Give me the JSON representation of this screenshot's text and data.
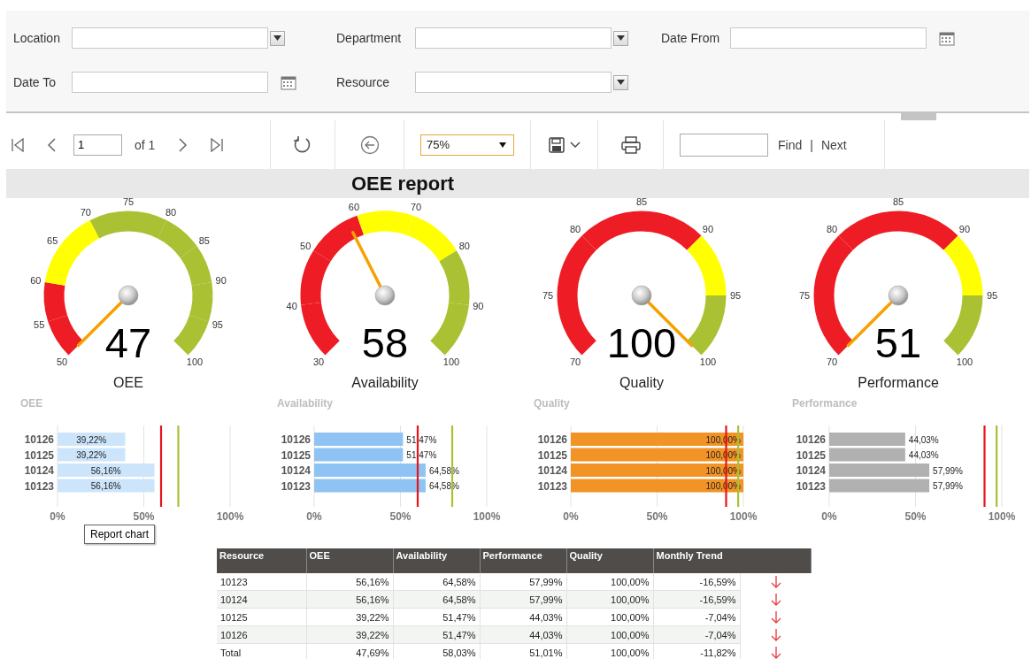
{
  "filters": [
    {
      "label": "Location",
      "kind": "select"
    },
    {
      "label": "Department",
      "kind": "select"
    },
    {
      "label": "Date From",
      "kind": "date"
    },
    {
      "label": "Date To",
      "kind": "date"
    },
    {
      "label": "Resource",
      "kind": "select"
    }
  ],
  "toolbar": {
    "page": "1",
    "page_count": "of 1",
    "zoom": "75%",
    "find_button": "Find",
    "separator": "|",
    "next_button": "Next"
  },
  "report_title": "OEE report",
  "gauges": [
    {
      "label": "OEE",
      "value": "47",
      "ticks": [
        "50",
        "55",
        "60",
        "65",
        "70",
        "75",
        "80",
        "85",
        "90",
        "95",
        "100"
      ],
      "segments": [
        {
          "color": "#ee1c25"
        },
        {
          "color": "#ee1c25"
        },
        {
          "color": "#ffff00"
        },
        {
          "color": "#ffff00"
        },
        {
          "color": "#a9c133"
        },
        {
          "color": "#a9c133"
        },
        {
          "color": "#a9c133"
        },
        {
          "color": "#a9c133"
        },
        {
          "color": "#a9c133"
        },
        {
          "color": "#a9c133"
        }
      ]
    },
    {
      "label": "Availability",
      "value": "58",
      "ticks": [
        "30",
        "40",
        "50",
        "60",
        "70",
        "80",
        "90",
        "100"
      ],
      "segments": [
        {
          "color": "#ee1c25"
        },
        {
          "color": "#ee1c25"
        },
        {
          "color": "#ee1c25"
        },
        {
          "color": "#ffff00"
        },
        {
          "color": "#ffff00"
        },
        {
          "color": "#a9c133"
        },
        {
          "color": "#a9c133"
        }
      ]
    },
    {
      "label": "Quality",
      "value": "100",
      "ticks": [
        "70",
        "75",
        "80",
        "85",
        "90",
        "95",
        "100"
      ],
      "segments": [
        {
          "color": "#ee1c25"
        },
        {
          "color": "#ee1c25"
        },
        {
          "color": "#ee1c25"
        },
        {
          "color": "#ee1c25"
        },
        {
          "color": "#ffff00"
        },
        {
          "color": "#a9c133"
        }
      ]
    },
    {
      "label": "Performance",
      "value": "51",
      "ticks": [
        "70",
        "75",
        "80",
        "85",
        "90",
        "95",
        "100"
      ],
      "segments": [
        {
          "color": "#ee1c25"
        },
        {
          "color": "#ee1c25"
        },
        {
          "color": "#ee1c25"
        },
        {
          "color": "#ee1c25"
        },
        {
          "color": "#ffff00"
        },
        {
          "color": "#a9c133"
        }
      ]
    }
  ],
  "charts": [
    {
      "chart_data": {
        "type": "bar",
        "orientation": "horizontal",
        "title": "OEE",
        "categories": [
          "10126",
          "10125",
          "10124",
          "10123"
        ],
        "series": [
          {
            "color": "#cde5fb",
            "values": [
              39.22,
              39.22,
              56.16,
              56.16
            ]
          }
        ],
        "xlim": [
          0,
          100
        ],
        "xticks": [
          {
            "value": 0,
            "label": "0%"
          },
          {
            "value": 50,
            "label": "50%"
          },
          {
            "value": 100,
            "label": "100%"
          }
        ],
        "value_labels": [
          "39,22%",
          "39,22%",
          "56,16%",
          "56,16%"
        ],
        "ref_lines": [
          {
            "axis": "x",
            "value": 60,
            "color": "#e8141c"
          },
          {
            "axis": "x",
            "value": 70,
            "color": "#a9c133"
          }
        ]
      }
    },
    {
      "chart_data": {
        "type": "bar",
        "orientation": "horizontal",
        "title": "Availability",
        "categories": [
          "10126",
          "10125",
          "10124",
          "10123"
        ],
        "series": [
          {
            "color": "#8ec3f3",
            "values": [
              51.47,
              51.47,
              64.58,
              64.58
            ]
          }
        ],
        "xlim": [
          0,
          100
        ],
        "xticks": [
          {
            "value": 0,
            "label": "0%"
          },
          {
            "value": 50,
            "label": "50%"
          },
          {
            "value": 100,
            "label": "100%"
          }
        ],
        "value_labels": [
          "51,47%",
          "51,47%",
          "64,58%",
          "64,58%"
        ],
        "ref_lines": [
          {
            "axis": "x",
            "value": 60,
            "color": "#e8141c"
          },
          {
            "axis": "x",
            "value": 80,
            "color": "#a9c133"
          }
        ]
      }
    },
    {
      "chart_data": {
        "type": "bar",
        "orientation": "horizontal",
        "title": "Quality",
        "categories": [
          "10126",
          "10125",
          "10124",
          "10123"
        ],
        "series": [
          {
            "color": "#f29325",
            "values": [
              100,
              100,
              100,
              100
            ]
          }
        ],
        "xlim": [
          0,
          100
        ],
        "xticks": [
          {
            "value": 0,
            "label": "0%"
          },
          {
            "value": 50,
            "label": "50%"
          },
          {
            "value": 100,
            "label": "100%"
          }
        ],
        "value_labels": [
          "100,00%",
          "100,00%",
          "100,00%",
          "100,00%"
        ],
        "ref_lines": [
          {
            "axis": "x",
            "value": 90,
            "color": "#e8141c"
          },
          {
            "axis": "x",
            "value": 97,
            "color": "#a9c133"
          }
        ]
      }
    },
    {
      "chart_data": {
        "type": "bar",
        "orientation": "horizontal",
        "title": "Performance",
        "categories": [
          "10126",
          "10125",
          "10124",
          "10123"
        ],
        "series": [
          {
            "color": "#b1b1b1",
            "values": [
              44.03,
              44.03,
              57.99,
              57.99
            ]
          }
        ],
        "xlim": [
          0,
          100
        ],
        "xticks": [
          {
            "value": 0,
            "label": "0%"
          },
          {
            "value": 50,
            "label": "50%"
          },
          {
            "value": 100,
            "label": "100%"
          }
        ],
        "value_labels": [
          "44,03%",
          "44,03%",
          "57,99%",
          "57,99%"
        ],
        "ref_lines": [
          {
            "axis": "x",
            "value": 90,
            "color": "#e8141c"
          },
          {
            "axis": "x",
            "value": 97,
            "color": "#a9c133"
          }
        ]
      }
    }
  ],
  "tooltip": "Report chart",
  "table": {
    "columns": [
      "Resource",
      "OEE",
      "Availability",
      "Performance",
      "Quality",
      "Monthly Trend"
    ],
    "rows": [
      {
        "cells": [
          "10123",
          "56,16%",
          "64,58%",
          "57,99%",
          "100,00%",
          "-16,59%"
        ],
        "falling": true
      },
      {
        "cells": [
          "10124",
          "56,16%",
          "64,58%",
          "57,99%",
          "100,00%",
          "-16,59%"
        ],
        "falling": true
      },
      {
        "cells": [
          "10125",
          "39,22%",
          "51,47%",
          "44,03%",
          "100,00%",
          "-7,04%"
        ],
        "falling": true
      },
      {
        "cells": [
          "10126",
          "39,22%",
          "51,47%",
          "44,03%",
          "100,00%",
          "-7,04%"
        ],
        "falling": true
      },
      {
        "cells": [
          "Total",
          "47,69%",
          "58,03%",
          "51,01%",
          "100,00%",
          "-11,82%"
        ],
        "falling": true
      }
    ]
  }
}
